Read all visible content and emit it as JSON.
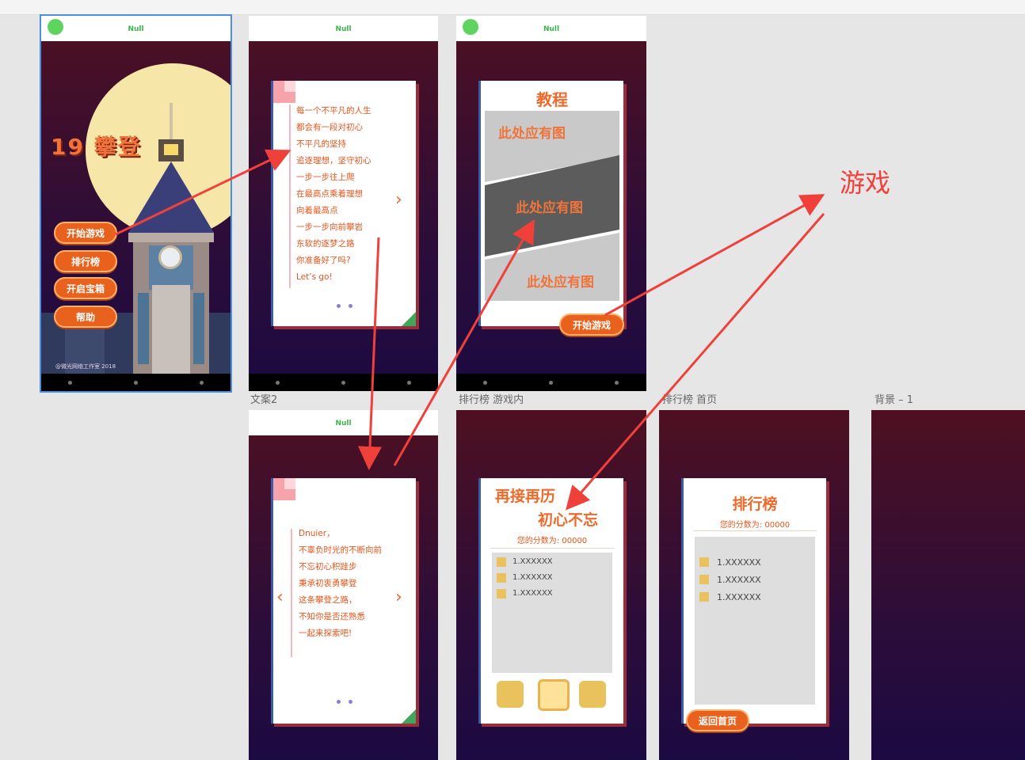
{
  "colors": {
    "accent": "#ee6a2b",
    "annotation": "#f0403a",
    "status_green": "#3bb54a"
  },
  "home": {
    "status_title": "Null",
    "title": "19 攀登",
    "buttons": [
      "开始游戏",
      "排行榜",
      "开启宝箱",
      "帮助"
    ],
    "copyright": "@微光网络工作室 2018"
  },
  "copy1": {
    "status_title": "Null",
    "lines": [
      "每一个不平凡的人生",
      "都会有一段对初心",
      "不平凡的坚持",
      "追逐理想，坚守初心",
      "一步一步往上爬",
      "在最高点乘着理想",
      "向着最高点",
      "一步一步向前攀岩",
      "东软的逐梦之路",
      "你准备好了吗?",
      "Let’s go!"
    ],
    "next_icon": "chevron-right-icon"
  },
  "tutorial": {
    "status_title": "Null",
    "title": "教程",
    "placeholders": [
      "此处应有图",
      "此处应有图",
      "此处应有图"
    ],
    "start_button": "开始游戏"
  },
  "copy2": {
    "label": "文案2",
    "status_title": "Null",
    "lines": [
      "Dnuier，",
      "不辜负时光的不断向前",
      "不忘初心积跬步",
      "秉承初衷勇攀登",
      "这条攀登之路，",
      "不知你是否还熟悉",
      "一起来探索吧!"
    ]
  },
  "rank_ingame": {
    "label": "排行榜 游戏内",
    "title_line1": "再接再历",
    "title_line2": "初心不忘",
    "score": "您的分数为: 00000",
    "items": [
      "1.XXXXXX",
      "1.XXXXXX",
      "1.XXXXXX"
    ]
  },
  "rank_home": {
    "label": "排行榜 首页",
    "title": "排行榜",
    "score": "您的分数为: 00000",
    "items": [
      "1.XXXXXX",
      "1.XXXXXX",
      "1.XXXXXX"
    ],
    "back_button": "返回首页"
  },
  "bg": {
    "label": "背景 – 1"
  },
  "annotation": {
    "text": "游戏"
  }
}
